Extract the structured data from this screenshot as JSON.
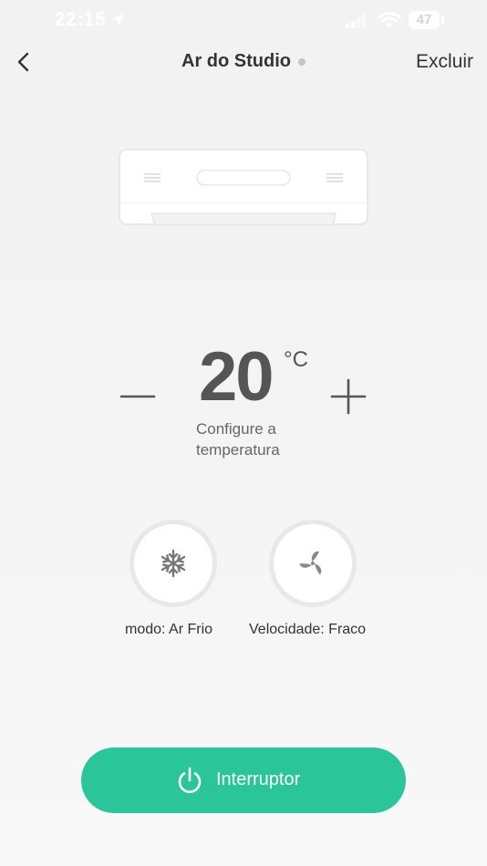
{
  "status_bar": {
    "time": "22:15",
    "battery": "47"
  },
  "header": {
    "title": "Ar do Studio",
    "delete_label": "Excluir"
  },
  "temperature": {
    "value": "20",
    "unit": "°C",
    "caption": "Configure a temperatura"
  },
  "controls": {
    "mode_label": "modo: Ar Frio",
    "fan_label": "Velocidade: Fraco"
  },
  "power": {
    "label": "Interruptor"
  },
  "colors": {
    "accent": "#2bc59a",
    "status_dot": "#c4c4c4",
    "text": "#333333"
  },
  "icons": {
    "back": "chevron-left-icon",
    "mode": "snowflake-icon",
    "fan": "fan-icon",
    "power": "power-icon",
    "location": "location-arrow-icon",
    "signal": "signal-icon",
    "wifi": "wifi-icon"
  }
}
